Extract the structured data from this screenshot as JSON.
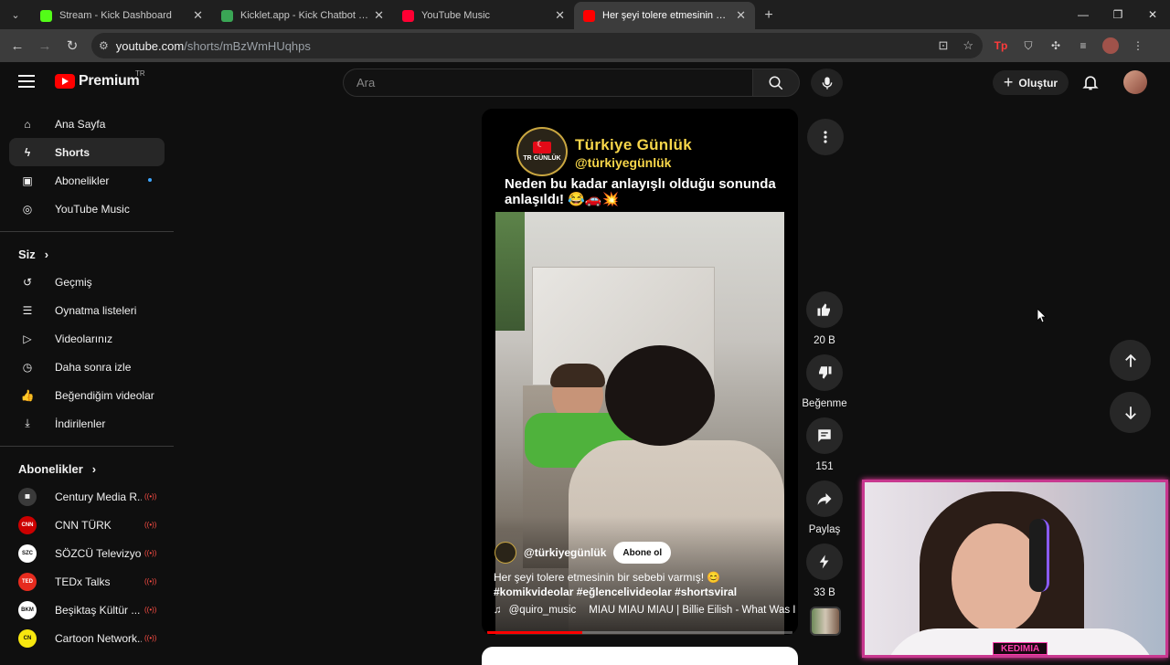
{
  "browser": {
    "tabs": [
      {
        "title": "Stream - Kick Dashboard",
        "favicon_color": "#53fc18",
        "active": false
      },
      {
        "title": "Kicklet.app - Kick Chatbot and",
        "favicon_color": "#3aa655",
        "active": false
      },
      {
        "title": "YouTube Music",
        "favicon_color": "#ff0033",
        "active": false
      },
      {
        "title": "Her şeyi tolere etmesinin bir sebebi",
        "favicon_color": "#ff0000",
        "active": true
      }
    ],
    "url_host": "youtube.com",
    "url_path": "/shorts/mBzWmHUqhps"
  },
  "header": {
    "brand": "Premium",
    "country_code": "TR",
    "search_placeholder": "Ara",
    "create_label": "Oluştur"
  },
  "sidebar": {
    "main": [
      {
        "label": "Ana Sayfa",
        "icon": "home-icon"
      },
      {
        "label": "Shorts",
        "icon": "shorts-icon",
        "active": true
      },
      {
        "label": "Abonelikler",
        "icon": "subscriptions-icon",
        "new_dot": true
      },
      {
        "label": "YouTube Music",
        "icon": "youtube-music-icon"
      }
    ],
    "you_heading": "Siz",
    "you": [
      {
        "label": "Geçmiş",
        "icon": "history-icon"
      },
      {
        "label": "Oynatma listeleri",
        "icon": "playlists-icon"
      },
      {
        "label": "Videolarınız",
        "icon": "your-videos-icon"
      },
      {
        "label": "Daha sonra izle",
        "icon": "watch-later-icon"
      },
      {
        "label": "Beğendiğim videolar",
        "icon": "liked-videos-icon"
      },
      {
        "label": "İndirilenler",
        "icon": "downloads-icon"
      }
    ],
    "subs_heading": "Abonelikler",
    "subscriptions": [
      {
        "name": "Century Media R...",
        "color": "#3a3a3a",
        "abbr": "▦"
      },
      {
        "name": "CNN TÜRK",
        "color": "#cc0000",
        "abbr": "CNN"
      },
      {
        "name": "SÖZCÜ Televizyo...",
        "color": "#ffffff",
        "abbr": "SZC"
      },
      {
        "name": "TEDx Talks",
        "color": "#e62b1e",
        "abbr": "TED"
      },
      {
        "name": "Beşiktaş Kültür ...",
        "color": "#ffffff",
        "abbr": "BKM"
      },
      {
        "name": "Cartoon Network...",
        "color": "#f7e70f",
        "abbr": "CN"
      }
    ]
  },
  "short": {
    "overlay_title": "Türkiye Günlük",
    "overlay_handle": "@türkiyegünlük",
    "overlay_logo_text": "TR GÜNLÜK",
    "caption": "Neden bu kadar anlayışlı olduğu sonunda anlaşıldı! 😂🚗💥",
    "channel": "@türkiyegünlük",
    "subscribe_label": "Abone ol",
    "description": "Her şeyi tolere etmesinin bir sebebi varmış! 😊",
    "hashtags": "#komikvideolar #eğlencelivideolar #shortsviral",
    "music_artist": "@quiro_music",
    "music_title": "MIAU MIAU MIAU | Billie Eilish - What Was I",
    "progress_fraction": 0.31
  },
  "actions": {
    "likes": "20 B",
    "dislike_label": "Beğenme",
    "comments": "151",
    "share_label": "Paylaş",
    "remixes": "33 B"
  },
  "webcam": {
    "label": "KEDIMIA"
  }
}
